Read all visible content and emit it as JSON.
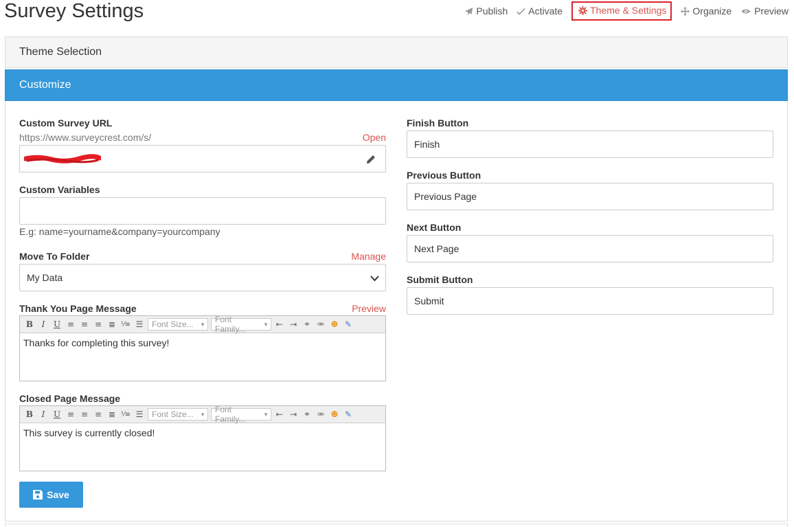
{
  "page": {
    "title": "Survey Settings"
  },
  "nav": {
    "publish": "Publish",
    "activate": "Activate",
    "theme_settings": "Theme & Settings",
    "organize": "Organize",
    "preview": "Preview"
  },
  "panels": {
    "theme_selection": "Theme Selection",
    "customize": "Customize"
  },
  "custom_url": {
    "label": "Custom Survey URL",
    "prefix": "https://www.surveycrest.com/s/",
    "open_link": "Open"
  },
  "custom_variables": {
    "label": "Custom Variables",
    "value": "",
    "hint": "E.g: name=yourname&company=yourcompany"
  },
  "folder": {
    "label": "Move To Folder",
    "manage_link": "Manage",
    "selected": "My Data"
  },
  "thank_you": {
    "label": "Thank You Page Message",
    "preview_link": "Preview",
    "content": "Thanks for completing this survey!"
  },
  "closed": {
    "label": "Closed Page Message",
    "content": "This survey is currently closed!"
  },
  "editor_toolbar": {
    "font_size": "Font Size...",
    "font_family": "Font Family..."
  },
  "finish_button": {
    "label": "Finish Button",
    "value": "Finish"
  },
  "previous_button": {
    "label": "Previous Button",
    "value": "Previous Page"
  },
  "next_button": {
    "label": "Next Button",
    "value": "Next Page"
  },
  "submit_button": {
    "label": "Submit Button",
    "value": "Submit"
  },
  "save": {
    "label": "Save"
  },
  "colors": {
    "primary": "#3498db",
    "link": "#d9534f",
    "highlight_border": "#d9242e"
  }
}
